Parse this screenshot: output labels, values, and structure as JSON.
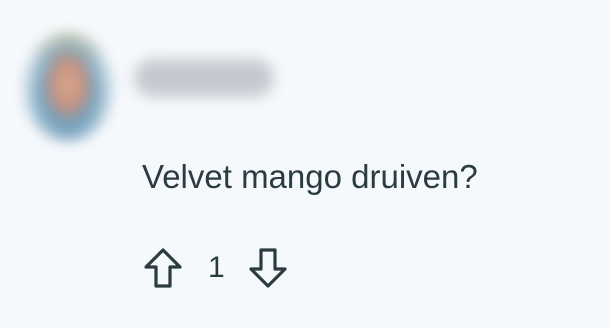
{
  "comment": {
    "author": "",
    "body": "Velvet mango druiven?",
    "score": "1"
  },
  "icons": {
    "upvote": "upvote-arrow-icon",
    "downvote": "downvote-arrow-icon"
  },
  "colors": {
    "background": "#f6f9fc",
    "text": "#2a3c42",
    "icon_stroke": "#2a3c42"
  }
}
